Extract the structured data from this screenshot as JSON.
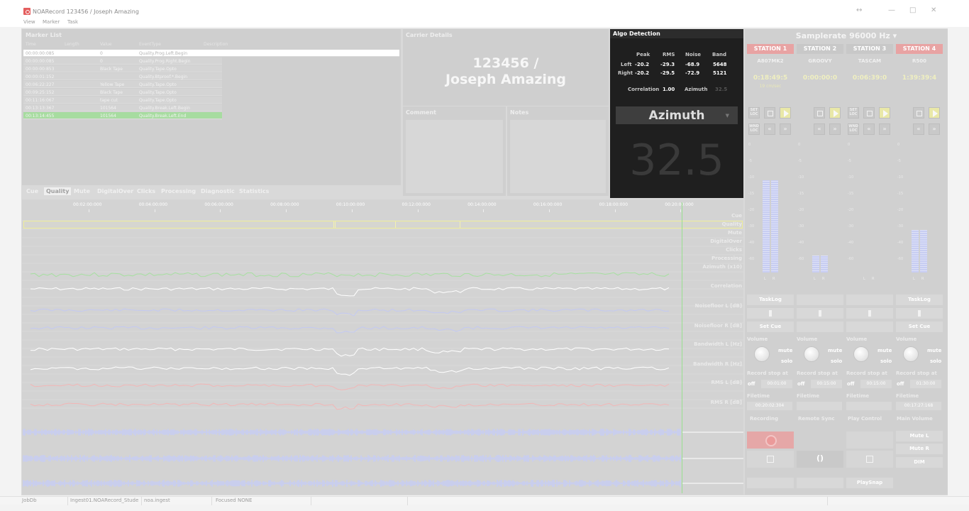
{
  "window": {
    "title": "NOARecord 123456 / Joseph Amazing",
    "restore_glyph": "↔",
    "minimize_glyph": "—",
    "maximize_glyph": "□",
    "close_glyph": "✕"
  },
  "menu": [
    "View",
    "Marker",
    "Task"
  ],
  "marker_list": {
    "title": "Marker List",
    "columns": [
      "Time",
      "Length",
      "Value",
      "EventType",
      "Description"
    ],
    "rows": [
      {
        "time": "00:00:00:085",
        "length": "",
        "value": "0",
        "event": "Quality.Prog.Left.Begin",
        "selected": true
      },
      {
        "time": "00:00:00:085",
        "length": "",
        "value": "0",
        "event": "Quality.Prog.Right.Begin"
      },
      {
        "time": "00:00:00:853",
        "length": "",
        "value": "Black Tape",
        "event": "Quality.Tape.Opto"
      },
      {
        "time": "00:00:01:152",
        "length": "",
        "value": "",
        "event": "Quality.Btproof.*.Begin"
      },
      {
        "time": "00:06:22:227",
        "length": "",
        "value": "Yellow Tape",
        "event": "Quality.Tape.Opto"
      },
      {
        "time": "00:09:25:152",
        "length": "",
        "value": "Black Tape",
        "event": "Quality.Tape.Opto"
      },
      {
        "time": "00:11:16:067",
        "length": "",
        "value": "tape cut",
        "event": "Quality.Tape.Opto"
      },
      {
        "time": "00:13:13:367",
        "length": "",
        "value": "101564",
        "event": "Quality.Break.Left.Begin"
      },
      {
        "time": "00:13:14:455",
        "length": "",
        "value": "101564",
        "event": "Quality.Break.Left.End",
        "highlight": true
      }
    ]
  },
  "tabs": [
    "Cue",
    "Quality",
    "Mute",
    "DigitalOver",
    "Clicks",
    "Processing",
    "Diagnostic",
    "Statistics"
  ],
  "carrier": {
    "title": "Carrier Details",
    "line1": "123456 /",
    "line2": "Joseph Amazing",
    "comment_title": "Comment",
    "notes_title": "Notes"
  },
  "algo": {
    "title": "Algo Detection",
    "headers": [
      "Peak",
      "RMS",
      "Noise",
      "Band"
    ],
    "left_label": "Left",
    "right_label": "Right",
    "left": [
      "-20.2",
      "-29.3",
      "-68.9",
      "5648"
    ],
    "right": [
      "-20.2",
      "-29.5",
      "-72.9",
      "5121"
    ],
    "correlation_label": "Correlation",
    "correlation_value": "1.00",
    "azimuth_label": "Azimuth",
    "azimuth_value": "32.5",
    "selected": "Azimuth",
    "big_value": "32.5"
  },
  "timeline": {
    "ruler": [
      "00:02:00:000",
      "00:04:00:000",
      "00:06:00:000",
      "00:08:00:000",
      "00:10:00:000",
      "00:12:00:000",
      "00:14:00:000",
      "00:16:00:000",
      "00:18:00:000",
      "00:20:00:000"
    ],
    "tracks": [
      "Cue",
      "Quality",
      "Mute",
      "DigitalOver",
      "Clicks",
      "Processing",
      "Azimuth (x10)",
      "Correlation",
      "Noisefloor L [dB]",
      "Noisefloor R [dB]",
      "Bandwidth L [Hz]",
      "Bandwidth R [Hz]",
      "RMS L [dB]",
      "RMS R [dB]"
    ],
    "colors": {
      "azimuth": "#a6e0a0",
      "correlation": "#ffffff",
      "noise": "#c3c9f2",
      "bandwidth": "#ffffff",
      "rms": "#f2b6b6",
      "wave": "#c7cdf4"
    }
  },
  "stations": {
    "samplerate_label": "Samplerate",
    "samplerate_value": "96000 Hz",
    "samplerate_arrow": "▾",
    "list": [
      {
        "name": "STATION 1",
        "model": "A807MK2",
        "time": "0:18:49:5",
        "speed": "19 cm/sec",
        "tasklog": "TaskLog",
        "setcue": "Set Cue",
        "stop_at": "00:01:00",
        "filetime": "00:20:02:304"
      },
      {
        "name": "STATION 2",
        "model": "GROOVY",
        "time": "0:00:00:0",
        "speed": "",
        "tasklog": "",
        "setcue": "",
        "stop_at": "00:15:00",
        "filetime": ""
      },
      {
        "name": "STATION 3",
        "model": "TASCAM",
        "time": "0:06:39:0",
        "speed": "",
        "tasklog": "",
        "setcue": "",
        "stop_at": "00:15:00",
        "filetime": ""
      },
      {
        "name": "STATION 4",
        "model": "R500",
        "time": "1:39:39:4",
        "speed": "",
        "tasklog": "TaskLog",
        "setcue": "Set Cue",
        "stop_at": "01:30:00",
        "filetime": "00:17:27:168"
      }
    ],
    "set_loc": "SET LOC",
    "wind_loc": "WND LOC",
    "volume_label": "Volume",
    "mute_label": "mute",
    "solo_label": "solo",
    "record_stop_label": "Record stop at",
    "off_label": "off",
    "filetime_label": "Filetime",
    "recording_label": "Recording",
    "remote_sync_label": "Remote Sync",
    "play_control_label": "Play Control",
    "main_volume_label": "Main Volume",
    "mute_l": "Mute L",
    "mute_r": "Mute R",
    "dim": "DIM",
    "playsnap": "PlaySnap",
    "meter_l": "L",
    "meter_r": "R"
  },
  "statusbar": {
    "db": "JobDb",
    "ingest": "Ingest01.NOARecord_Stude",
    "module": "noa.ingest",
    "focused": "Focused NONE"
  }
}
